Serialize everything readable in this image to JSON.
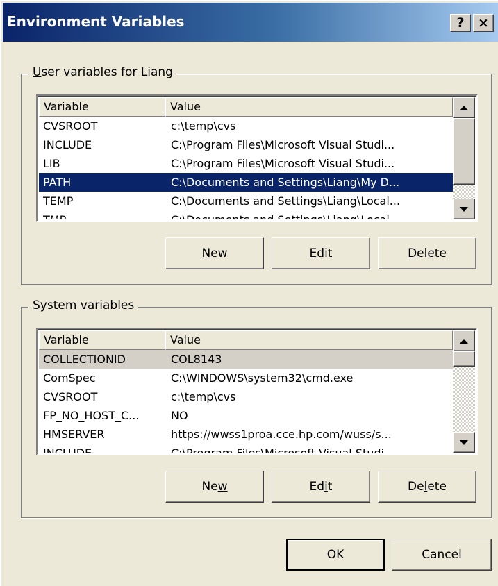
{
  "window": {
    "title": "Environment Variables",
    "help_label": "?",
    "close_label": "×"
  },
  "user_vars": {
    "group_prefix": "",
    "group_hotkey": "U",
    "group_rest": "ser variables for Liang",
    "headers": [
      "Variable",
      "Value"
    ],
    "rows": [
      {
        "name": "CVSROOT",
        "value": "c:\\temp\\cvs"
      },
      {
        "name": "INCLUDE",
        "value": "C:\\Program Files\\Microsoft Visual Studi..."
      },
      {
        "name": "LIB",
        "value": "C:\\Program Files\\Microsoft Visual Studi..."
      },
      {
        "name": "PATH",
        "value": "C:\\Documents and Settings\\Liang\\My D..."
      },
      {
        "name": "TEMP",
        "value": "C:\\Documents and Settings\\Liang\\Local..."
      },
      {
        "name": "TMP",
        "value": "C:\\Documents and Settings\\Liang\\Local..."
      }
    ],
    "selected_row": 3,
    "buttons": {
      "new": {
        "pre": "",
        "key": "N",
        "post": "ew"
      },
      "edit": {
        "pre": "",
        "key": "E",
        "post": "dit"
      },
      "delete": {
        "pre": "",
        "key": "D",
        "post": "elete"
      }
    }
  },
  "system_vars": {
    "group_prefix": "",
    "group_hotkey": "S",
    "group_rest": "ystem variables",
    "headers": [
      "Variable",
      "Value"
    ],
    "rows": [
      {
        "name": "COLLECTIONID",
        "value": "COL8143"
      },
      {
        "name": "ComSpec",
        "value": "C:\\WINDOWS\\system32\\cmd.exe"
      },
      {
        "name": "CVSROOT",
        "value": "c:\\temp\\cvs"
      },
      {
        "name": "FP_NO_HOST_C...",
        "value": "NO"
      },
      {
        "name": "HMSERVER",
        "value": "https://wwss1proa.cce.hp.com/wuss/s..."
      },
      {
        "name": "INCLUDE",
        "value": "C:\\Program Files\\Microsoft Visual Studi..."
      }
    ],
    "focused_row": 0,
    "buttons": {
      "new": {
        "pre": "Ne",
        "key": "w",
        "post": ""
      },
      "edit": {
        "pre": "Ed",
        "key": "i",
        "post": "t"
      },
      "delete": {
        "pre": "De",
        "key": "l",
        "post": "ete"
      }
    }
  },
  "footer": {
    "ok_label": "OK",
    "cancel_label": "Cancel"
  },
  "colors": {
    "selection": "#0a246a",
    "face": "#ece9d8"
  }
}
